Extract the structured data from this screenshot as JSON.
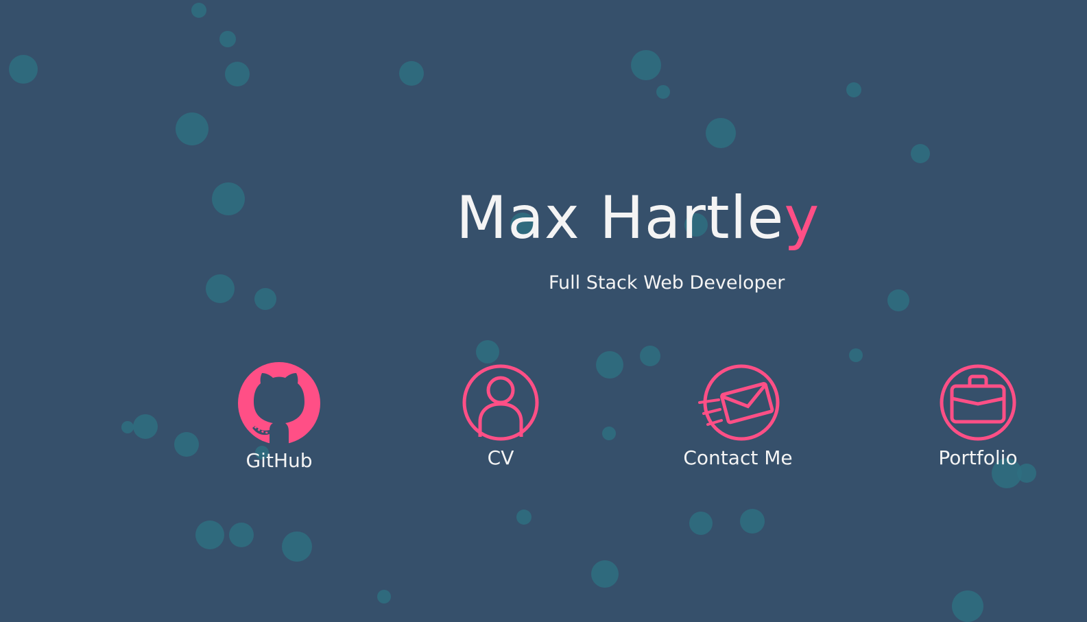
{
  "hero": {
    "name_main": "Max Hartle",
    "name_accent": "y",
    "subtitle": "Full Stack Web Developer"
  },
  "links": [
    {
      "label": "GitHub",
      "icon": "github-icon"
    },
    {
      "label": "CV",
      "icon": "person-icon"
    },
    {
      "label": "Contact Me",
      "icon": "envelope-icon"
    },
    {
      "label": "Portfolio",
      "icon": "briefcase-icon"
    }
  ],
  "colors": {
    "background": "#36506b",
    "accent": "#ff4f86",
    "text": "#f4f4f4",
    "bubble": "#2e6f80"
  }
}
